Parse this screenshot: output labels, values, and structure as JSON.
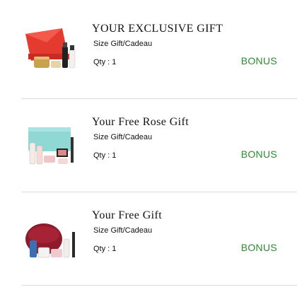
{
  "gifts": [
    {
      "title": "YOUR EXCLUSIVE GIFT",
      "size": "Size Gift/Cadeau",
      "qty": "Qty : 1",
      "badge": "BONUS",
      "image_icon": "red-pouch-gift-set-icon"
    },
    {
      "title": "Your Free Rose Gift",
      "size": "Size Gift/Cadeau",
      "qty": "Qty : 1",
      "badge": "BONUS",
      "image_icon": "teal-bag-gift-set-icon"
    },
    {
      "title": "Your Free Gift",
      "size": "Size Gift/Cadeau",
      "qty": "Qty : 1",
      "badge": "BONUS",
      "image_icon": "burgundy-pouch-gift-set-icon"
    }
  ],
  "colors": {
    "badge": "#2e8b2e",
    "divider": "#dcdcdc"
  }
}
